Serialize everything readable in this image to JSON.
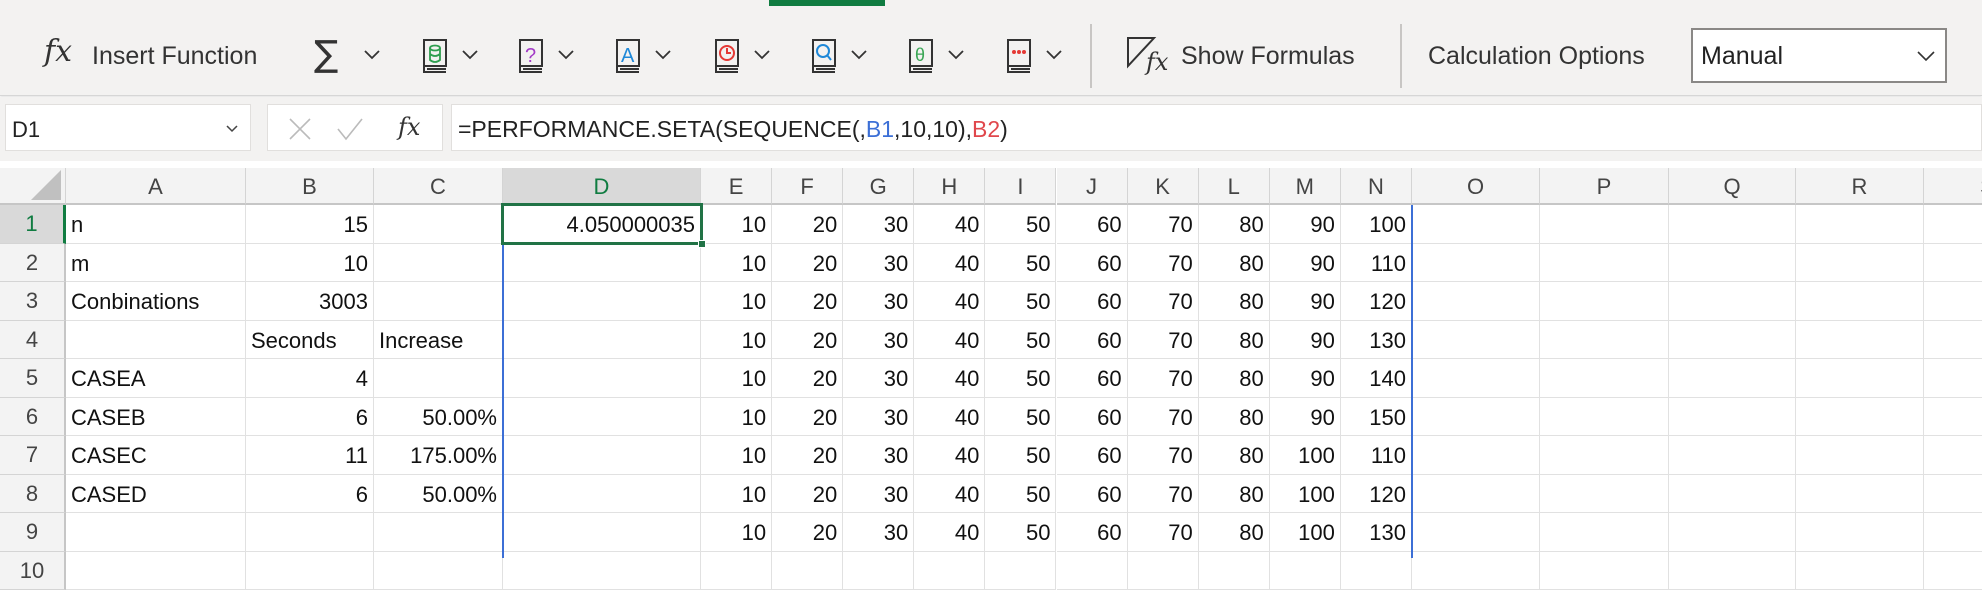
{
  "ribbon": {
    "insert_function_label": "Insert Function",
    "show_formulas_label": "Show Formulas",
    "calculation_options_label": "Calculation Options",
    "calculation_mode": "Manual",
    "icons": [
      "autosum-icon",
      "financial-icon",
      "logical-icon",
      "text-icon",
      "date-time-icon",
      "lookup-icon",
      "math-trig-icon",
      "more-functions-icon"
    ],
    "colors": {
      "accent": "#107c41",
      "financial": "#2e9e4f",
      "logical": "#a23bc6",
      "text": "#1e88d8",
      "date": "#e53935",
      "lookup": "#1e88d8",
      "math": "#3aa655",
      "more": "#e53935"
    }
  },
  "formula_bar": {
    "name_box": "D1",
    "formula_parts": [
      {
        "text": "=PERFORMANCE.SETA(SEQUENCE(,",
        "color": "#222222"
      },
      {
        "text": "B1",
        "color": "#3c6fd6"
      },
      {
        "text": ",10,10),",
        "color": "#222222"
      },
      {
        "text": "B2",
        "color": "#e0474c"
      },
      {
        "text": ")",
        "color": "#222222"
      }
    ]
  },
  "grid": {
    "columns": [
      "A",
      "B",
      "C",
      "D",
      "E",
      "F",
      "G",
      "H",
      "I",
      "J",
      "K",
      "L",
      "M",
      "N",
      "O",
      "P",
      "Q",
      "R",
      "S"
    ],
    "selected_column": "D",
    "selected_row": "1",
    "rows": [
      {
        "n": "1",
        "A": "n",
        "B": "15",
        "C": "",
        "D": "4.050000035",
        "E": "10",
        "F": "20",
        "G": "30",
        "H": "40",
        "I": "50",
        "J": "60",
        "K": "70",
        "L": "80",
        "M": "90",
        "N": "100"
      },
      {
        "n": "2",
        "A": "m",
        "B": "10",
        "C": "",
        "D": "",
        "E": "10",
        "F": "20",
        "G": "30",
        "H": "40",
        "I": "50",
        "J": "60",
        "K": "70",
        "L": "80",
        "M": "90",
        "N": "110"
      },
      {
        "n": "3",
        "A": "Conbinations",
        "B": "3003",
        "C": "",
        "D": "",
        "E": "10",
        "F": "20",
        "G": "30",
        "H": "40",
        "I": "50",
        "J": "60",
        "K": "70",
        "L": "80",
        "M": "90",
        "N": "120"
      },
      {
        "n": "4",
        "A": "",
        "B": "Seconds",
        "C": "Increase",
        "D": "",
        "E": "10",
        "F": "20",
        "G": "30",
        "H": "40",
        "I": "50",
        "J": "60",
        "K": "70",
        "L": "80",
        "M": "90",
        "N": "130"
      },
      {
        "n": "5",
        "A": "CASEA",
        "B": "4",
        "C": "",
        "D": "",
        "E": "10",
        "F": "20",
        "G": "30",
        "H": "40",
        "I": "50",
        "J": "60",
        "K": "70",
        "L": "80",
        "M": "90",
        "N": "140"
      },
      {
        "n": "6",
        "A": "CASEB",
        "B": "6",
        "C": "50.00%",
        "D": "",
        "E": "10",
        "F": "20",
        "G": "30",
        "H": "40",
        "I": "50",
        "J": "60",
        "K": "70",
        "L": "80",
        "M": "90",
        "N": "150"
      },
      {
        "n": "7",
        "A": "CASEC",
        "B": "11",
        "C": "175.00%",
        "D": "",
        "E": "10",
        "F": "20",
        "G": "30",
        "H": "40",
        "I": "50",
        "J": "60",
        "K": "70",
        "L": "80",
        "M": "100",
        "N": "110"
      },
      {
        "n": "8",
        "A": "CASED",
        "B": "6",
        "C": "50.00%",
        "D": "",
        "E": "10",
        "F": "20",
        "G": "30",
        "H": "40",
        "I": "50",
        "J": "60",
        "K": "70",
        "L": "80",
        "M": "100",
        "N": "120"
      },
      {
        "n": "9",
        "A": "",
        "B": "",
        "C": "",
        "D": "",
        "E": "10",
        "F": "20",
        "G": "30",
        "H": "40",
        "I": "50",
        "J": "60",
        "K": "70",
        "L": "80",
        "M": "100",
        "N": "130"
      },
      {
        "n": "10",
        "A": "",
        "B": "",
        "C": "",
        "D": "",
        "E": "",
        "F": "",
        "G": "",
        "H": "",
        "I": "",
        "J": "",
        "K": "",
        "L": "",
        "M": "",
        "N": ""
      }
    ]
  }
}
